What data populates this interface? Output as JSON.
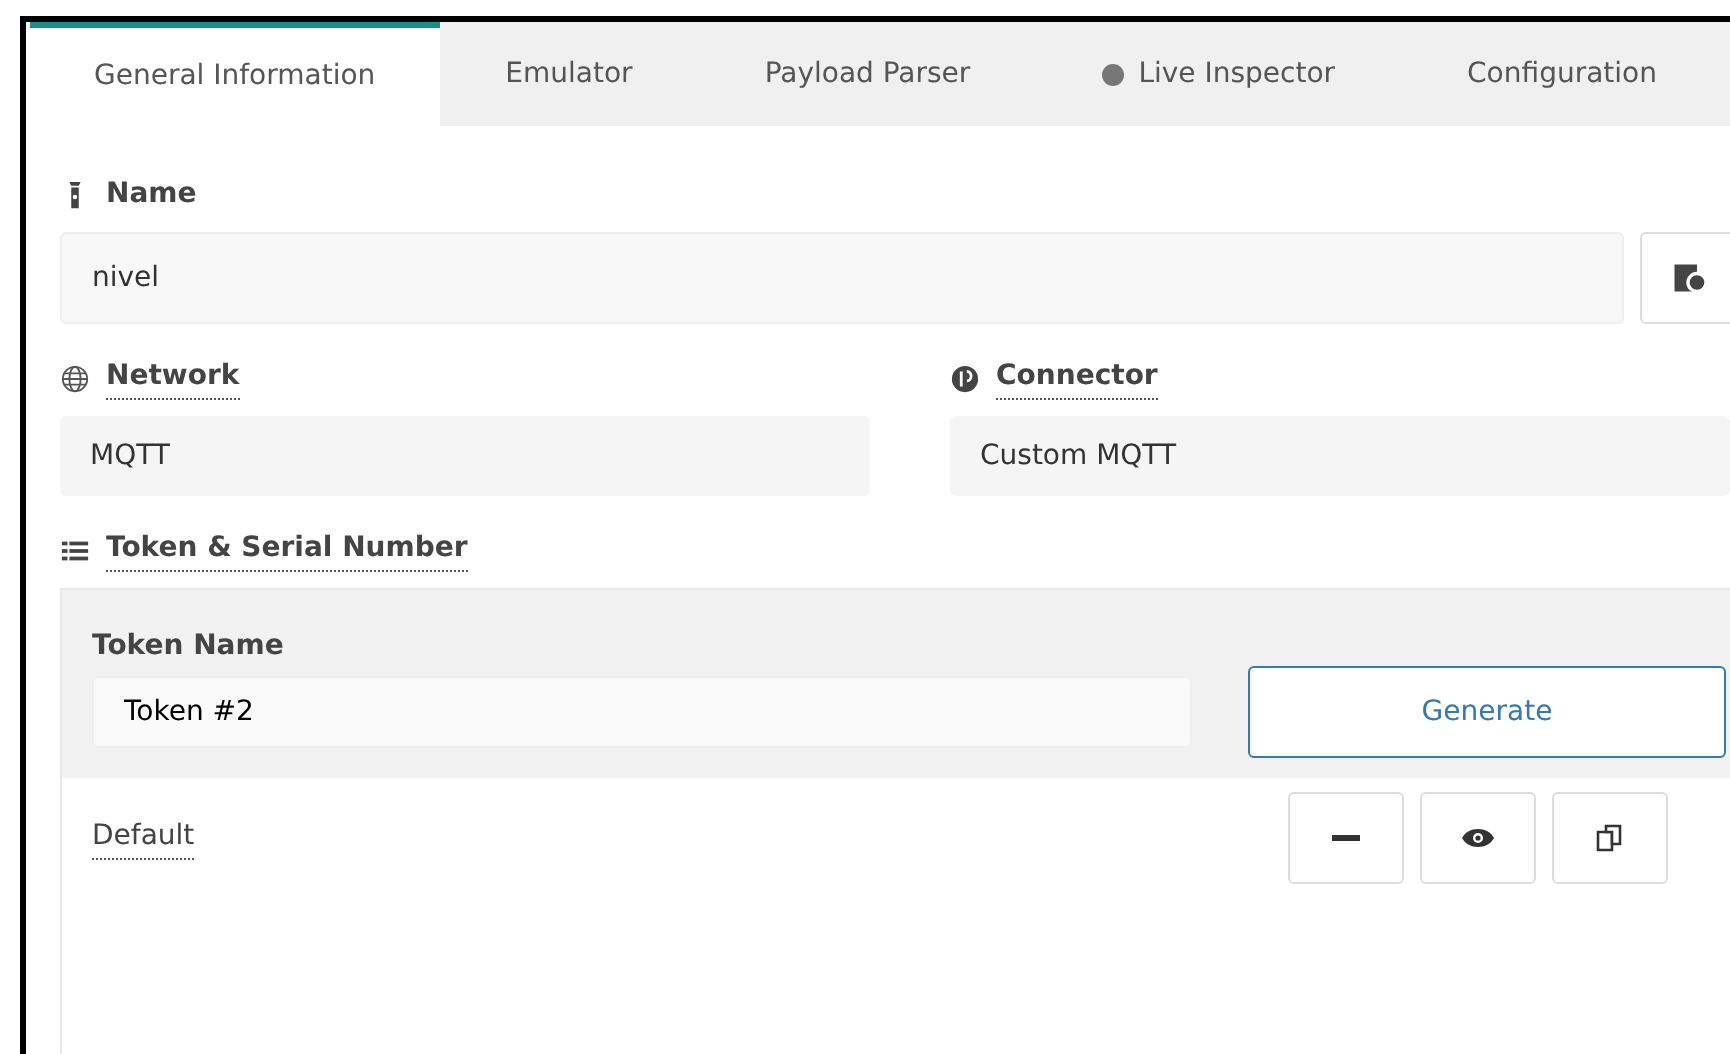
{
  "tabs": [
    {
      "label": "General Information",
      "selected": true,
      "status_dot": false
    },
    {
      "label": "Emulator",
      "selected": false,
      "status_dot": false
    },
    {
      "label": "Payload Parser",
      "selected": false,
      "status_dot": false
    },
    {
      "label": "Live Inspector",
      "selected": false,
      "status_dot": true
    },
    {
      "label": "Configuration",
      "selected": false,
      "status_dot": false
    }
  ],
  "name": {
    "label": "Name",
    "value": "nivel"
  },
  "network": {
    "label": "Network",
    "value": "MQTT"
  },
  "connector": {
    "label": "Connector",
    "value": "Custom MQTT"
  },
  "token_section": {
    "label": "Token & Serial Number",
    "token_name_label": "Token Name",
    "token_name_value": "Token #2",
    "generate_button": "Generate",
    "tokens": [
      {
        "name": "Default"
      }
    ]
  }
}
